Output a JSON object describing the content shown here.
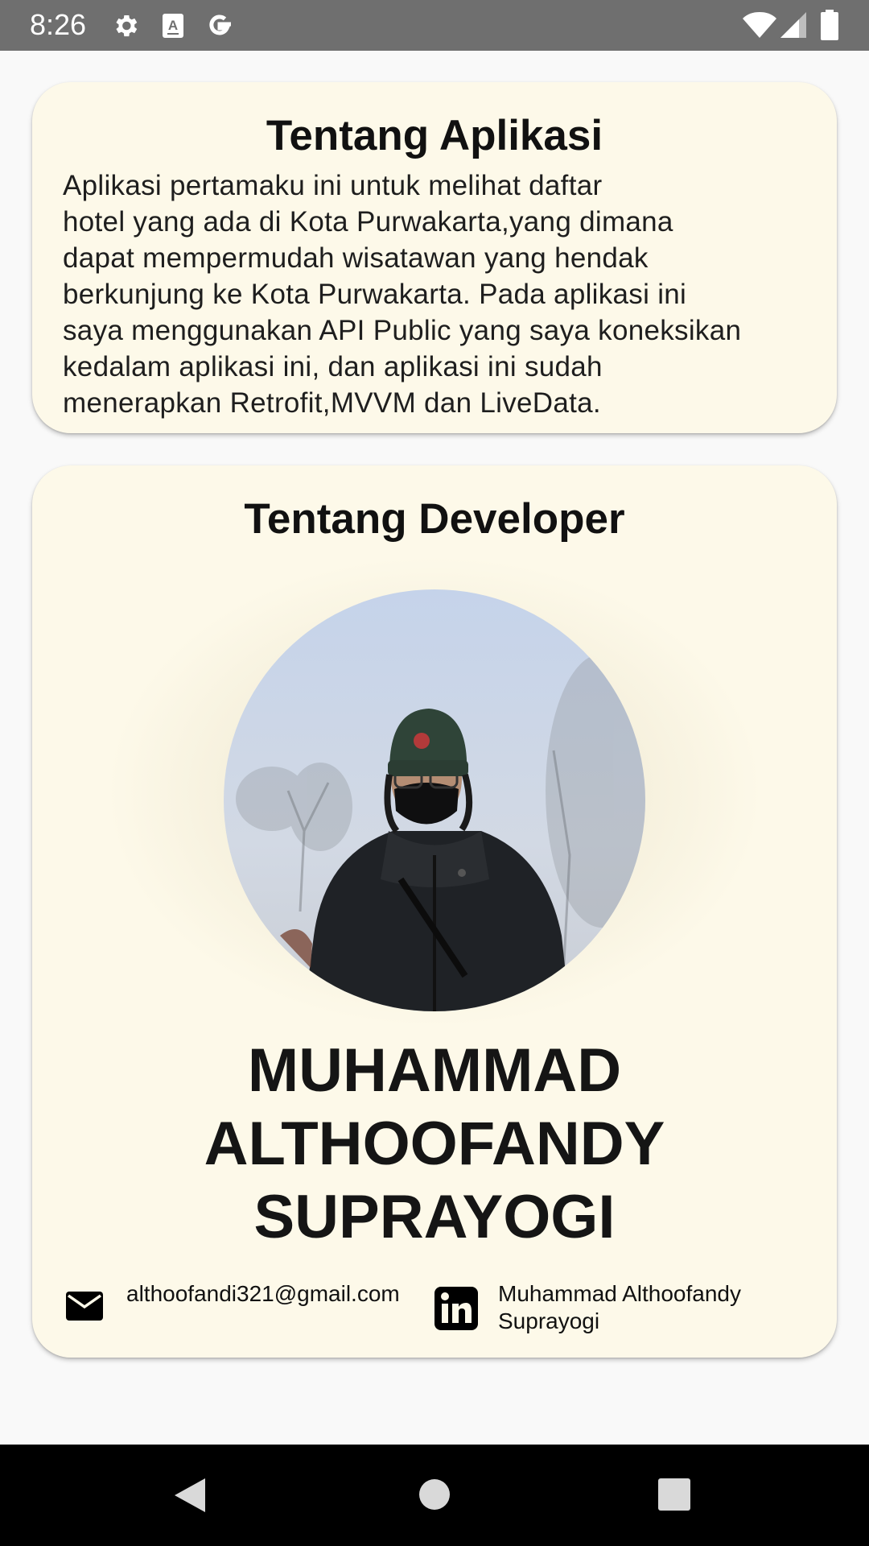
{
  "status_bar": {
    "time": "8:26",
    "icons": [
      "settings-icon",
      "keyboard-a-icon",
      "google-icon",
      "wifi-icon",
      "signal-icon",
      "battery-icon"
    ]
  },
  "about_card": {
    "title": "Tentang Aplikasi",
    "lines": [
      "Aplikasi pertamaku ini untuk melihat daftar",
      "hotel yang ada di Kota Purwakarta,yang dimana",
      "dapat mempermudah wisatawan yang hendak",
      "berkunjung ke Kota Purwakarta. Pada aplikasi ini",
      "saya menggunakan API Public yang saya koneksikan",
      "kedalam aplikasi ini, dan aplikasi ini sudah",
      "menerapkan Retrofit,MVVM dan LiveData."
    ]
  },
  "developer_card": {
    "title": "Tentang Developer",
    "name_lines": [
      "MUHAMMAD",
      "ALTHOOFANDY",
      "SUPRAYOGI"
    ],
    "email": "althoofandi321@gmail.com",
    "linkedin_lines": [
      "Muhammad Althoofandy",
      "Suprayogi"
    ]
  },
  "nav_bar": {
    "icons": [
      "back-icon",
      "home-icon",
      "recents-icon"
    ]
  },
  "colors": {
    "card_background": "#fdf9e9",
    "page_background": "#f9f9f9",
    "status_bar": "#6f6f6f",
    "nav_bar": "#000000"
  }
}
